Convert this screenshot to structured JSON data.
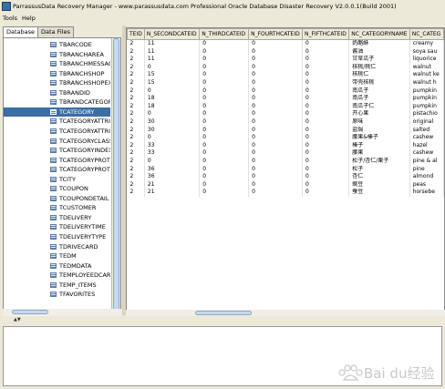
{
  "window": {
    "title": "ParrassusData Recovery Manager - www.parassusdata.com  Professional Oracle Database Disaster Recovery   V2.0.0.1(Build 2001)"
  },
  "menu": [
    {
      "label": "Tools"
    },
    {
      "label": "Help"
    }
  ],
  "tabs": [
    {
      "label": "Database",
      "active": true
    },
    {
      "label": "Data Files",
      "active": false
    }
  ],
  "tree": {
    "selected": "TCATEGORY",
    "items": [
      "TBARCODE",
      "TBRANCHAREA",
      "TBRANCHMESSAGE",
      "TBRANCHSHOP",
      "TBRANCHSHOPEXT",
      "TBRANDID",
      "TBRANDCATEGORY",
      "TCATEGORY",
      "TCATEGORYATTRIBUTE",
      "TCATEGORYATTRIB",
      "TCATEGORYCLASS",
      "TCATEGORYINDEX",
      "TCATEGORYPROTECT",
      "TCATEGORYPROTE",
      "TCITY",
      "TCOUPON",
      "TCOUPONDETAIL",
      "TCUSTOMER",
      "TDELIVERY",
      "TDELIVERYTIME",
      "TDELIVERYTYPE",
      "TDRIVECARD",
      "TEDM",
      "TEDMDATA",
      "TEMPLOYEEDCARD",
      "TEMP_ITEMS",
      "TFAVORITES"
    ]
  },
  "grid": {
    "columns": [
      "TEID",
      "N_SECONDCATEID",
      "N_THIRDCATEID",
      "N_FOURTHCATEID",
      "N_FIFTHCATEID",
      "NC_CATEGORYNAME",
      "NC_CATEG"
    ],
    "rows": [
      [
        "2",
        "11",
        "0",
        "0",
        "0",
        "奶酪酥",
        "creamy"
      ],
      [
        "2",
        "11",
        "0",
        "0",
        "0",
        "酱油",
        "soya sau"
      ],
      [
        "2",
        "11",
        "0",
        "0",
        "0",
        "甘草瓜子",
        "liquorice"
      ],
      [
        "2",
        "0",
        "0",
        "0",
        "0",
        "核桃/桃仁",
        "walnut"
      ],
      [
        "2",
        "15",
        "0",
        "0",
        "0",
        "核桃仁",
        "walnut ke"
      ],
      [
        "2",
        "15",
        "0",
        "0",
        "0",
        "带壳核桃",
        "walnut h"
      ],
      [
        "2",
        "0",
        "0",
        "0",
        "0",
        "南瓜子",
        "pumpkin"
      ],
      [
        "2",
        "18",
        "0",
        "0",
        "0",
        "南瓜子",
        "pumpkin"
      ],
      [
        "2",
        "18",
        "0",
        "0",
        "0",
        "南瓜子仁",
        "pumpkin"
      ],
      [
        "2",
        "0",
        "0",
        "0",
        "0",
        "开心果",
        "pistachio"
      ],
      [
        "2",
        "30",
        "0",
        "0",
        "0",
        "原味",
        "original"
      ],
      [
        "2",
        "30",
        "0",
        "0",
        "0",
        "盐焗",
        "salted"
      ],
      [
        "2",
        "0",
        "0",
        "0",
        "0",
        "腰果&榛子",
        "cashew"
      ],
      [
        "2",
        "33",
        "0",
        "0",
        "0",
        "榛子",
        "hazel"
      ],
      [
        "2",
        "33",
        "0",
        "0",
        "0",
        "腰果",
        "cashew"
      ],
      [
        "2",
        "0",
        "0",
        "0",
        "0",
        "松子/杏仁/栗子",
        "pine & al"
      ],
      [
        "2",
        "36",
        "0",
        "0",
        "0",
        "松子",
        "pine"
      ],
      [
        "2",
        "36",
        "0",
        "0",
        "0",
        "杏仁",
        "almond"
      ],
      [
        "2",
        "21",
        "0",
        "0",
        "0",
        "豌豆",
        "peas"
      ],
      [
        "2",
        "21",
        "0",
        "0",
        "0",
        "蚕豆",
        "horsebe"
      ]
    ]
  },
  "splitter": {
    "arrows": "▲▼"
  },
  "watermark": {
    "text": "Bai du经验"
  },
  "colors": {
    "selection": "#3a6ea5",
    "chrome": "#ece9d8"
  }
}
